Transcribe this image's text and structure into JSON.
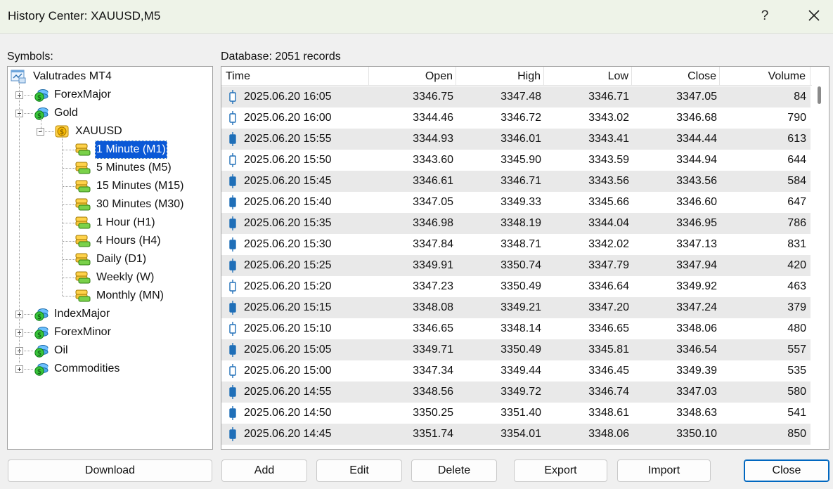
{
  "window": {
    "title": "History Center: XAUUSD,M5",
    "help_glyph": "?"
  },
  "symbols_label": "Symbols:",
  "database_label": "Database: 2051 records",
  "tree": {
    "root": "Valutrades MT4",
    "groups": [
      {
        "label": "ForexMajor"
      },
      {
        "label": "Gold",
        "expanded": true,
        "symbol": "XAUUSD",
        "timeframes": [
          "1 Minute (M1)",
          "5 Minutes (M5)",
          "15 Minutes (M15)",
          "30 Minutes (M30)",
          "1 Hour (H1)",
          "4 Hours (H4)",
          "Daily (D1)",
          "Weekly (W)",
          "Monthly (MN)"
        ],
        "selected_timeframe": "1 Minute (M1)"
      },
      {
        "label": "IndexMajor"
      },
      {
        "label": "ForexMinor"
      },
      {
        "label": "Oil"
      },
      {
        "label": "Commodities"
      }
    ]
  },
  "table": {
    "columns": [
      "Time",
      "Open",
      "High",
      "Low",
      "Close",
      "Volume"
    ],
    "rows": [
      {
        "time": "2025.06.20 16:05",
        "open": "3346.75",
        "high": "3347.48",
        "low": "3346.71",
        "close": "3347.05",
        "volume": "84",
        "bull": true
      },
      {
        "time": "2025.06.20 16:00",
        "open": "3344.46",
        "high": "3346.72",
        "low": "3343.02",
        "close": "3346.68",
        "volume": "790",
        "bull": true
      },
      {
        "time": "2025.06.20 15:55",
        "open": "3344.93",
        "high": "3346.01",
        "low": "3343.41",
        "close": "3344.44",
        "volume": "613",
        "bull": false
      },
      {
        "time": "2025.06.20 15:50",
        "open": "3343.60",
        "high": "3345.90",
        "low": "3343.59",
        "close": "3344.94",
        "volume": "644",
        "bull": true
      },
      {
        "time": "2025.06.20 15:45",
        "open": "3346.61",
        "high": "3346.71",
        "low": "3343.56",
        "close": "3343.56",
        "volume": "584",
        "bull": false
      },
      {
        "time": "2025.06.20 15:40",
        "open": "3347.05",
        "high": "3349.33",
        "low": "3345.66",
        "close": "3346.60",
        "volume": "647",
        "bull": false
      },
      {
        "time": "2025.06.20 15:35",
        "open": "3346.98",
        "high": "3348.19",
        "low": "3344.04",
        "close": "3346.95",
        "volume": "786",
        "bull": false
      },
      {
        "time": "2025.06.20 15:30",
        "open": "3347.84",
        "high": "3348.71",
        "low": "3342.02",
        "close": "3347.13",
        "volume": "831",
        "bull": false
      },
      {
        "time": "2025.06.20 15:25",
        "open": "3349.91",
        "high": "3350.74",
        "low": "3347.79",
        "close": "3347.94",
        "volume": "420",
        "bull": false
      },
      {
        "time": "2025.06.20 15:20",
        "open": "3347.23",
        "high": "3350.49",
        "low": "3346.64",
        "close": "3349.92",
        "volume": "463",
        "bull": true
      },
      {
        "time": "2025.06.20 15:15",
        "open": "3348.08",
        "high": "3349.21",
        "low": "3347.20",
        "close": "3347.24",
        "volume": "379",
        "bull": false
      },
      {
        "time": "2025.06.20 15:10",
        "open": "3346.65",
        "high": "3348.14",
        "low": "3346.65",
        "close": "3348.06",
        "volume": "480",
        "bull": true
      },
      {
        "time": "2025.06.20 15:05",
        "open": "3349.71",
        "high": "3350.49",
        "low": "3345.81",
        "close": "3346.54",
        "volume": "557",
        "bull": false
      },
      {
        "time": "2025.06.20 15:00",
        "open": "3347.34",
        "high": "3349.44",
        "low": "3346.45",
        "close": "3349.39",
        "volume": "535",
        "bull": true
      },
      {
        "time": "2025.06.20 14:55",
        "open": "3348.56",
        "high": "3349.72",
        "low": "3346.74",
        "close": "3347.03",
        "volume": "580",
        "bull": false
      },
      {
        "time": "2025.06.20 14:50",
        "open": "3350.25",
        "high": "3351.40",
        "low": "3348.61",
        "close": "3348.63",
        "volume": "541",
        "bull": false
      },
      {
        "time": "2025.06.20 14:45",
        "open": "3351.74",
        "high": "3354.01",
        "low": "3348.06",
        "close": "3350.10",
        "volume": "850",
        "bull": false
      }
    ]
  },
  "buttons": {
    "download": "Download",
    "add": "Add",
    "edit": "Edit",
    "delete": "Delete",
    "export": "Export",
    "import": "Import",
    "close": "Close"
  },
  "colors": {
    "selection": "#0a58d6",
    "candle": "#1f6fb8",
    "alt_row": "#e9e9e9"
  }
}
